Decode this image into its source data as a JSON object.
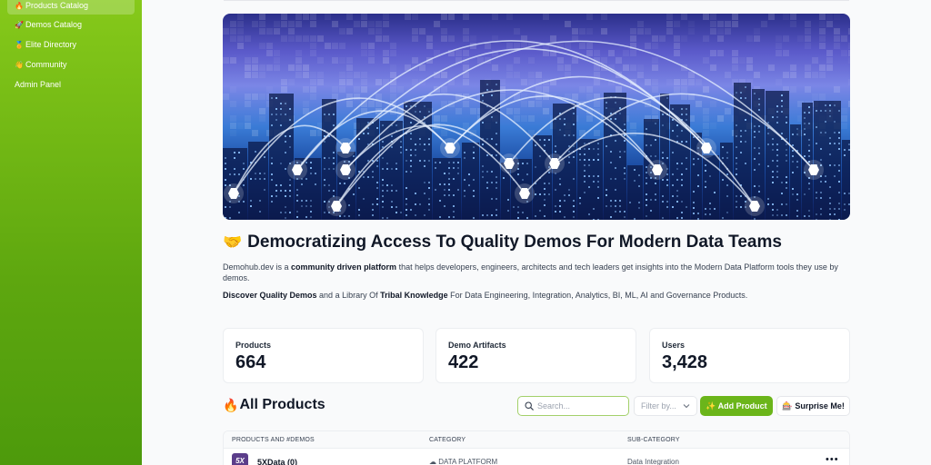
{
  "sidebar": {
    "items": [
      {
        "icon": "🔥",
        "label": "Products Catalog",
        "active": true
      },
      {
        "icon": "🚀",
        "label": "Demos Catalog",
        "active": false
      },
      {
        "icon": "🏅",
        "label": "Elite Directory",
        "active": false
      },
      {
        "icon": "👋",
        "label": "Community",
        "active": false
      },
      {
        "icon": "",
        "label": "Admin Panel",
        "active": false
      }
    ]
  },
  "hero": {
    "headline_emoji": "🤝",
    "headline": "Democratizing Access To Quality Demos For Modern Data Teams",
    "desc_prefix": "Demohub.dev is a ",
    "desc_bold": "community driven platform",
    "desc_suffix": " that helps developers, engineers, architects and tech leaders get insights into the Modern Data Platform tools they use by demos.",
    "desc2_bold1": "Discover Quality Demos",
    "desc2_mid": " and a Library Of ",
    "desc2_bold2": "Tribal Knowledge",
    "desc2_suffix": " For Data Engineering, Integration, Analytics, BI, ML, AI and Governance Products."
  },
  "stats": [
    {
      "label": "Products",
      "value": "664"
    },
    {
      "label": "Demo Artifacts",
      "value": "422"
    },
    {
      "label": "Users",
      "value": "3,428"
    }
  ],
  "products": {
    "title_emoji": "🔥",
    "title": "All Products",
    "search_placeholder": "Search...",
    "filter_placeholder": "Filter by...",
    "add_icon": "✨",
    "add_label": "Add Product",
    "surprise_icon": "🎰",
    "surprise_label": "Surprise Me!",
    "columns": [
      "PRODUCTS AND #DEMOS",
      "CATEGORY",
      "SUB-CATEGORY"
    ],
    "rows": [
      {
        "logo_text": "5X",
        "name": "5XData (0)",
        "category_icon": "☁",
        "category": "DATA PLATFORM",
        "subcategory": "Data Integration",
        "more": "•••"
      }
    ]
  },
  "colors": {
    "sidebar_top": "#86c91a",
    "sidebar_bottom": "#4d9a0c",
    "accent": "#6bb51a"
  }
}
